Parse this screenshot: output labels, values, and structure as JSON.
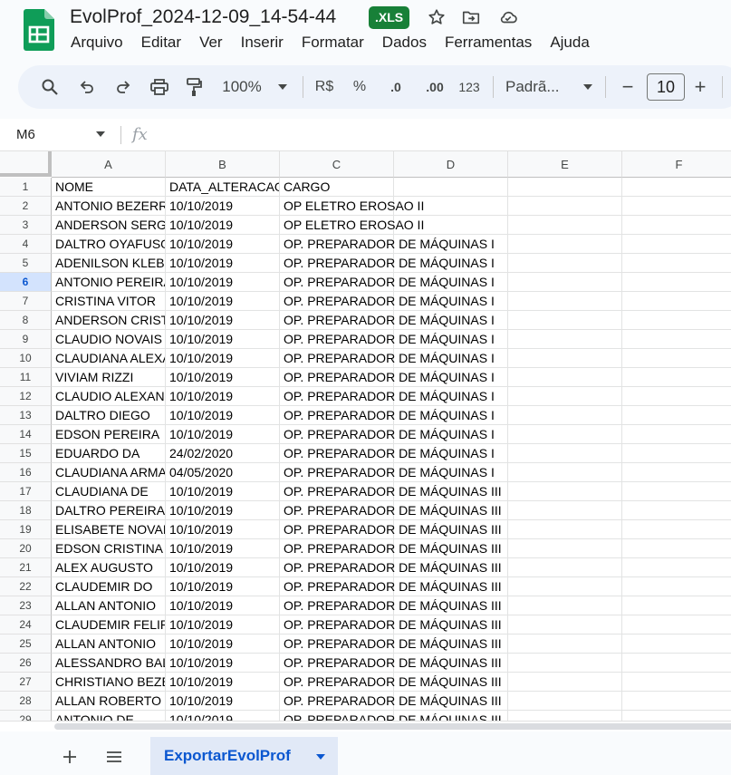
{
  "document": {
    "title": "EvolProf_2024-12-09_14-54-44",
    "format_badge": ".XLS"
  },
  "menu": [
    "Arquivo",
    "Editar",
    "Ver",
    "Inserir",
    "Formatar",
    "Dados",
    "Ferramentas",
    "Ajuda"
  ],
  "toolbar": {
    "zoom": "100%",
    "currency": "R$",
    "percent": "%",
    "decrease_decimal": ".0",
    "increase_decimal": ".00",
    "number_format": "123",
    "font": "Padrã...",
    "minus": "−",
    "font_size": "10",
    "plus": "+"
  },
  "formula_bar": {
    "name_box": "M6",
    "fx": "fx"
  },
  "grid": {
    "columns": [
      "A",
      "B",
      "C",
      "D",
      "E",
      "F"
    ],
    "selected_row": "6",
    "rows": [
      {
        "n": "1",
        "a": "NOME",
        "b": "DATA_ALTERACAO",
        "c": "CARGO"
      },
      {
        "n": "2",
        "a": "ANTONIO BEZERRA",
        "b": "10/10/2019",
        "c": "OP ELETRO EROSAO II"
      },
      {
        "n": "3",
        "a": "ANDERSON SERGIO",
        "b": "10/10/2019",
        "c": "OP ELETRO EROSAO II"
      },
      {
        "n": "4",
        "a": "DALTRO OYAFUSO",
        "b": "10/10/2019",
        "c": "OP. PREPARADOR DE MÁQUINAS I"
      },
      {
        "n": "5",
        "a": "ADENILSON KLEBER",
        "b": "10/10/2019",
        "c": "OP. PREPARADOR DE MÁQUINAS I"
      },
      {
        "n": "6",
        "a": "ANTONIO PEREIRA",
        "b": "10/10/2019",
        "c": "OP. PREPARADOR DE MÁQUINAS I"
      },
      {
        "n": "7",
        "a": "CRISTINA VITOR",
        "b": "10/10/2019",
        "c": "OP. PREPARADOR DE MÁQUINAS I"
      },
      {
        "n": "8",
        "a": "ANDERSON CRISTI",
        "b": "10/10/2019",
        "c": "OP. PREPARADOR DE MÁQUINAS I"
      },
      {
        "n": "9",
        "a": "CLAUDIO NOVAIS",
        "b": "10/10/2019",
        "c": "OP. PREPARADOR DE MÁQUINAS I"
      },
      {
        "n": "10",
        "a": "CLAUDIANA ALEXA",
        "b": "10/10/2019",
        "c": "OP. PREPARADOR DE MÁQUINAS I"
      },
      {
        "n": "11",
        "a": "VIVIAM RIZZI",
        "b": "10/10/2019",
        "c": "OP. PREPARADOR DE MÁQUINAS I"
      },
      {
        "n": "12",
        "a": "CLAUDIO ALEXAND",
        "b": "10/10/2019",
        "c": "OP. PREPARADOR DE MÁQUINAS I"
      },
      {
        "n": "13",
        "a": "DALTRO DIEGO",
        "b": "10/10/2019",
        "c": "OP. PREPARADOR DE MÁQUINAS I"
      },
      {
        "n": "14",
        "a": "EDSON PEREIRA",
        "b": "10/10/2019",
        "c": "OP. PREPARADOR DE MÁQUINAS I"
      },
      {
        "n": "15",
        "a": "EDUARDO DA",
        "b": "24/02/2020",
        "c": "OP. PREPARADOR DE MÁQUINAS I"
      },
      {
        "n": "16",
        "a": "CLAUDIANA ARMA",
        "b": "04/05/2020",
        "c": "OP. PREPARADOR DE MÁQUINAS I"
      },
      {
        "n": "17",
        "a": "CLAUDIANA DE",
        "b": "10/10/2019",
        "c": "OP. PREPARADOR DE MÁQUINAS III"
      },
      {
        "n": "18",
        "a": "DALTRO PEREIRA",
        "b": "10/10/2019",
        "c": "OP. PREPARADOR DE MÁQUINAS III"
      },
      {
        "n": "19",
        "a": "ELISABETE NOVAIS",
        "b": "10/10/2019",
        "c": "OP. PREPARADOR DE MÁQUINAS III"
      },
      {
        "n": "20",
        "a": "EDSON CRISTINA",
        "b": "10/10/2019",
        "c": "OP. PREPARADOR DE MÁQUINAS III"
      },
      {
        "n": "21",
        "a": "ALEX AUGUSTO",
        "b": "10/10/2019",
        "c": "OP. PREPARADOR DE MÁQUINAS III"
      },
      {
        "n": "22",
        "a": "CLAUDEMIR DO",
        "b": "10/10/2019",
        "c": "OP. PREPARADOR DE MÁQUINAS III"
      },
      {
        "n": "23",
        "a": "ALLAN ANTONIO",
        "b": "10/10/2019",
        "c": "OP. PREPARADOR DE MÁQUINAS III"
      },
      {
        "n": "24",
        "a": "CLAUDEMIR FELIPE",
        "b": "10/10/2019",
        "c": "OP. PREPARADOR DE MÁQUINAS III"
      },
      {
        "n": "25",
        "a": "ALLAN ANTONIO",
        "b": "10/10/2019",
        "c": "OP. PREPARADOR DE MÁQUINAS III"
      },
      {
        "n": "26",
        "a": "ALESSANDRO BALL",
        "b": "10/10/2019",
        "c": "OP. PREPARADOR DE MÁQUINAS III"
      },
      {
        "n": "27",
        "a": "CHRISTIANO BEZEF",
        "b": "10/10/2019",
        "c": "OP. PREPARADOR DE MÁQUINAS III"
      },
      {
        "n": "28",
        "a": "ALLAN ROBERTO",
        "b": "10/10/2019",
        "c": "OP. PREPARADOR DE MÁQUINAS III"
      },
      {
        "n": "29",
        "a": "ANTONIO DE",
        "b": "10/10/2019",
        "c": "OP. PREPARADOR DE MÁQUINAS III"
      }
    ]
  },
  "sheets": {
    "active": "ExportarEvolProf"
  },
  "colors": {
    "accent": "#0b57d0",
    "badge": "#188038",
    "toolbar_bg": "#edf2fa",
    "selected_header": "#d3e3fd"
  }
}
